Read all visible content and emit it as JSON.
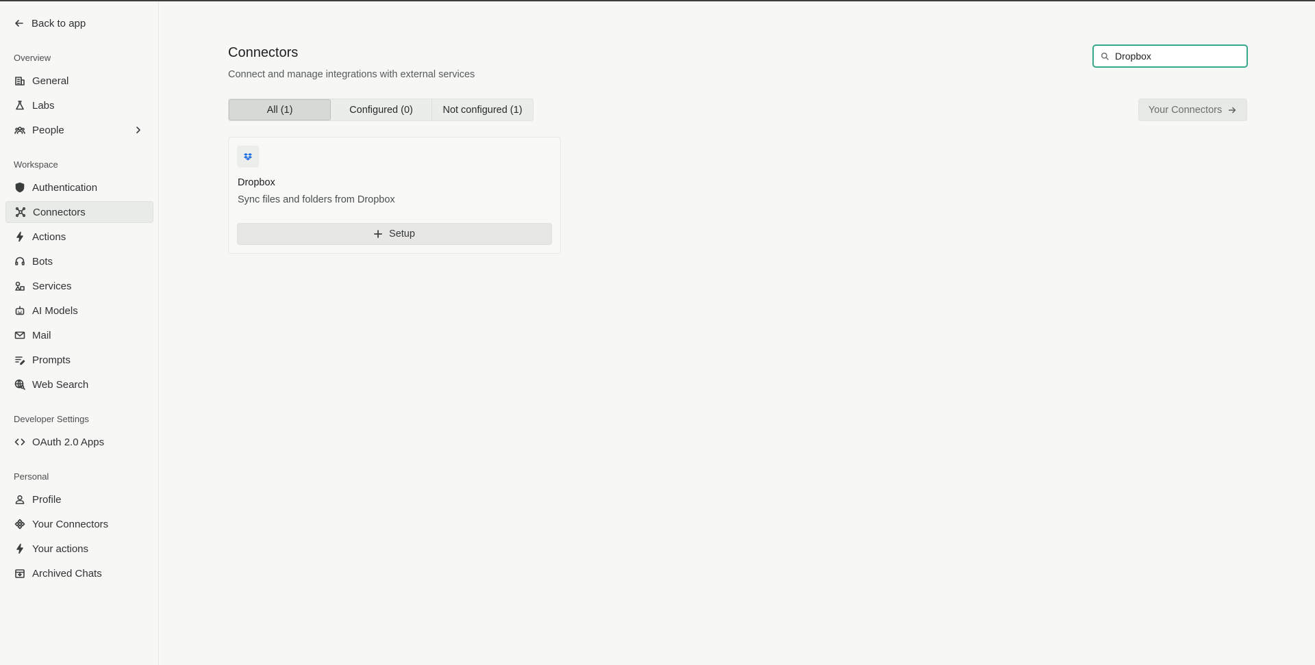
{
  "sidebar": {
    "back_label": "Back to app",
    "sections": {
      "overview": "Overview",
      "workspace": "Workspace",
      "developer": "Developer Settings",
      "personal": "Personal"
    },
    "items": {
      "general": "General",
      "labs": "Labs",
      "people": "People",
      "authentication": "Authentication",
      "connectors": "Connectors",
      "actions": "Actions",
      "bots": "Bots",
      "services": "Services",
      "ai_models": "AI Models",
      "mail": "Mail",
      "prompts": "Prompts",
      "web_search": "Web Search",
      "oauth_apps": "OAuth 2.0 Apps",
      "profile": "Profile",
      "your_connectors": "Your Connectors",
      "your_actions": "Your actions",
      "archived_chats": "Archived Chats"
    },
    "active_item": "connectors"
  },
  "main": {
    "title": "Connectors",
    "subtitle": "Connect and manage integrations with external services",
    "search": {
      "value": "Dropbox"
    },
    "tabs": [
      {
        "label": "All (1)",
        "active": true
      },
      {
        "label": "Configured (0)",
        "active": false
      },
      {
        "label": "Not configured (1)",
        "active": false
      }
    ],
    "your_connectors_button": "Your Connectors",
    "cards": [
      {
        "icon": "dropbox-icon",
        "title": "Dropbox",
        "description": "Sync files and folders from Dropbox",
        "action_label": "Setup"
      }
    ]
  },
  "colors": {
    "accent": "#34a889",
    "dropbox_blue": "#1f6fe0"
  }
}
